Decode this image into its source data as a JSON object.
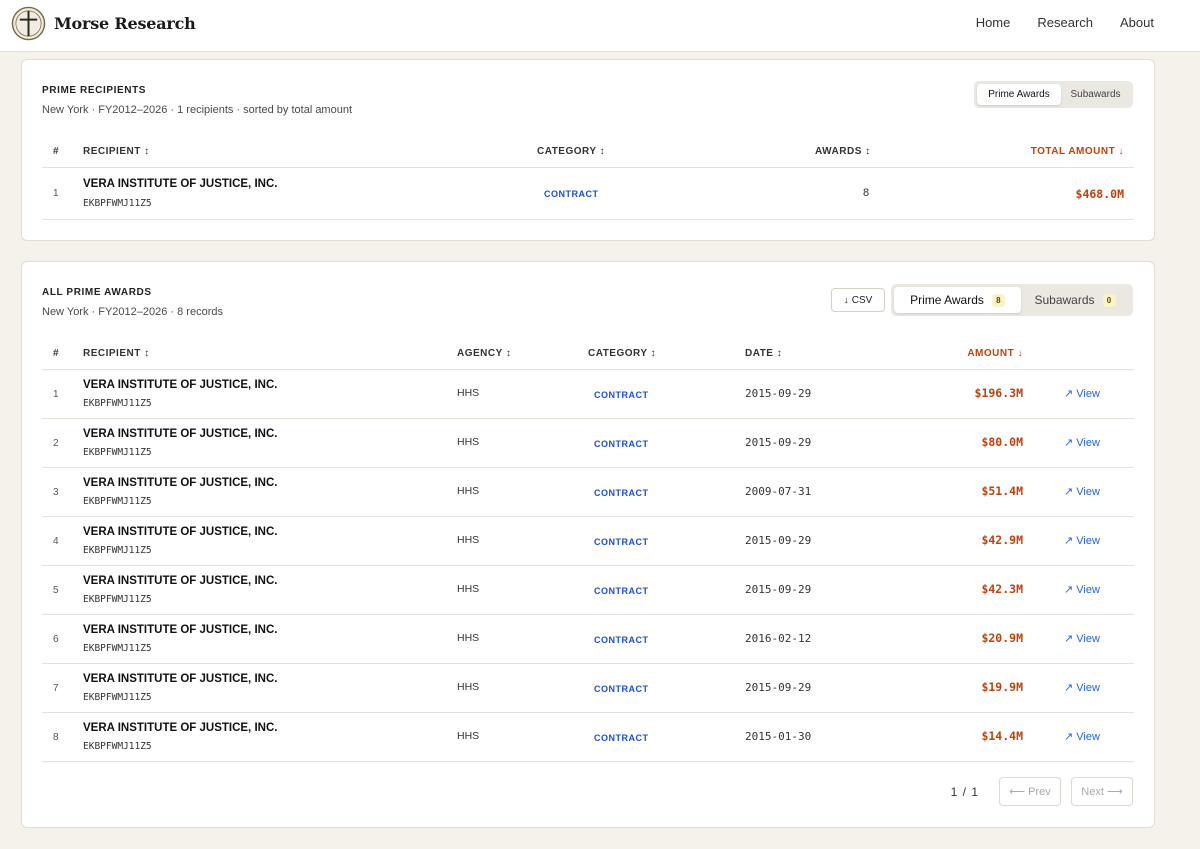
{
  "header": {
    "brand": "Morse Research",
    "nav": [
      "Home",
      "Research",
      "About"
    ]
  },
  "recipients": {
    "title": "PRIME RECIPIENTS",
    "subtitle": "New York · FY2012–2026 · 1 recipients · sorted by total amount",
    "tabs": {
      "active": "Prime Awards",
      "other": "Subawards"
    },
    "columns": {
      "num": "#",
      "recipient": "RECIPIENT ↕",
      "category": "CATEGORY ↕",
      "awards": "AWARDS ↕",
      "total": "TOTAL AMOUNT ↓"
    },
    "rows": [
      {
        "num": "1",
        "name": "VERA INSTITUTE OF JUSTICE, INC.",
        "uei": "EKBPFWMJ11Z5",
        "category": "CONTRACT",
        "awards": "8",
        "total": "$468.0M"
      }
    ]
  },
  "awards": {
    "title": "ALL PRIME AWARDS",
    "subtitle": "New York · FY2012–2026 · 8 records",
    "csv_label": "CSV",
    "tabs": {
      "active": "Prime Awards",
      "active_count": "8",
      "other": "Subawards",
      "other_count": "0"
    },
    "columns": {
      "num": "#",
      "recipient": "RECIPIENT ↕",
      "agency": "AGENCY ↕",
      "category": "CATEGORY ↕",
      "date": "DATE ↕",
      "amount": "AMOUNT ↓"
    },
    "view_label": "View",
    "rows": [
      {
        "num": "1",
        "name": "VERA INSTITUTE OF JUSTICE, INC.",
        "uei": "EKBPFWMJ11Z5",
        "agency": "HHS",
        "category": "CONTRACT",
        "date": "2015-09-29",
        "amount": "$196.3M"
      },
      {
        "num": "2",
        "name": "VERA INSTITUTE OF JUSTICE, INC.",
        "uei": "EKBPFWMJ11Z5",
        "agency": "HHS",
        "category": "CONTRACT",
        "date": "2015-09-29",
        "amount": "$80.0M"
      },
      {
        "num": "3",
        "name": "VERA INSTITUTE OF JUSTICE, INC.",
        "uei": "EKBPFWMJ11Z5",
        "agency": "HHS",
        "category": "CONTRACT",
        "date": "2009-07-31",
        "amount": "$51.4M"
      },
      {
        "num": "4",
        "name": "VERA INSTITUTE OF JUSTICE, INC.",
        "uei": "EKBPFWMJ11Z5",
        "agency": "HHS",
        "category": "CONTRACT",
        "date": "2015-09-29",
        "amount": "$42.9M"
      },
      {
        "num": "5",
        "name": "VERA INSTITUTE OF JUSTICE, INC.",
        "uei": "EKBPFWMJ11Z5",
        "agency": "HHS",
        "category": "CONTRACT",
        "date": "2015-09-29",
        "amount": "$42.3M"
      },
      {
        "num": "6",
        "name": "VERA INSTITUTE OF JUSTICE, INC.",
        "uei": "EKBPFWMJ11Z5",
        "agency": "HHS",
        "category": "CONTRACT",
        "date": "2016-02-12",
        "amount": "$20.9M"
      },
      {
        "num": "7",
        "name": "VERA INSTITUTE OF JUSTICE, INC.",
        "uei": "EKBPFWMJ11Z5",
        "agency": "HHS",
        "category": "CONTRACT",
        "date": "2015-09-29",
        "amount": "$19.9M"
      },
      {
        "num": "8",
        "name": "VERA INSTITUTE OF JUSTICE, INC.",
        "uei": "EKBPFWMJ11Z5",
        "agency": "HHS",
        "category": "CONTRACT",
        "date": "2015-01-30",
        "amount": "$14.4M"
      }
    ],
    "pagination": {
      "current": "1",
      "separator": "/",
      "total": "1",
      "prev": "⟵ Prev",
      "next": "Next ⟶"
    }
  },
  "colors": {
    "accent": "#c2410c",
    "link": "#2563eb",
    "category": "#1d4ed8",
    "page_bg": "#f5f2ec"
  },
  "icons": {
    "logo": "cross-compass-logo",
    "sort": "sort-arrows-icon",
    "download": "download-arrow-icon",
    "external": "external-link-icon"
  }
}
